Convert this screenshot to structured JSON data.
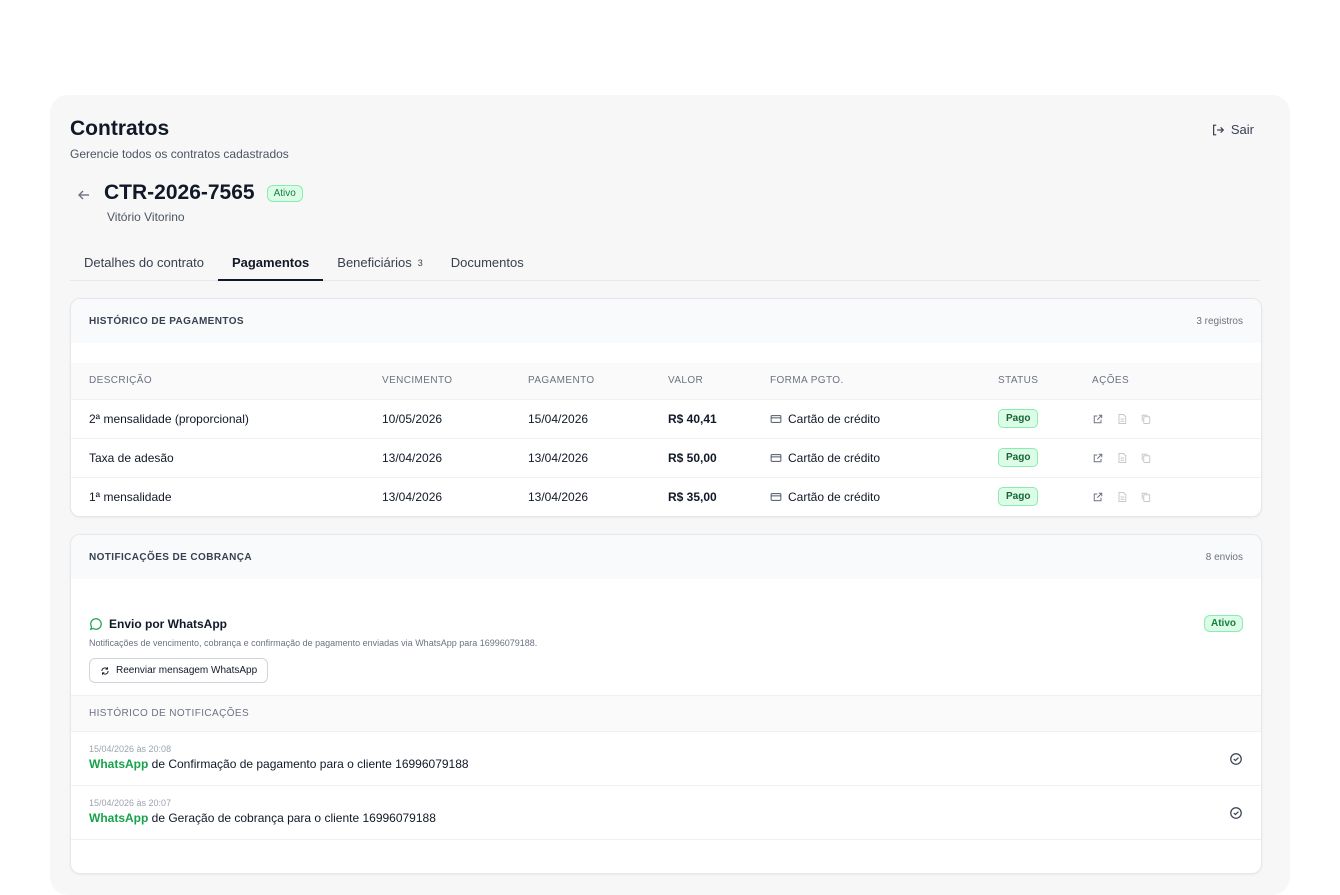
{
  "header": {
    "title": "Contratos",
    "subtitle": "Gerencie todos os contratos cadastrados",
    "logout_label": "Sair"
  },
  "contract": {
    "id": "CTR-2026-7565",
    "status": "Ativo",
    "client": "Vitório Vitorino"
  },
  "tabs": [
    {
      "label": "Detalhes do contrato",
      "active": false
    },
    {
      "label": "Pagamentos",
      "active": true
    },
    {
      "label": "Beneficiários",
      "count": "3",
      "active": false
    },
    {
      "label": "Documentos",
      "active": false
    }
  ],
  "payments": {
    "title": "HISTÓRICO DE PAGAMENTOS",
    "count": "3 registros",
    "columns": [
      "DESCRIÇÃO",
      "VENCIMENTO",
      "PAGAMENTO",
      "VALOR",
      "FORMA PGTO.",
      "STATUS",
      "AÇÕES"
    ],
    "rows": [
      {
        "descricao": "2ª mensalidade (proporcional)",
        "vencimento": "10/05/2026",
        "pagamento": "15/04/2026",
        "valor": "R$ 40,41",
        "forma": "Cartão de crédito",
        "status": "Pago"
      },
      {
        "descricao": "Taxa de adesão",
        "vencimento": "13/04/2026",
        "pagamento": "13/04/2026",
        "valor": "R$ 50,00",
        "forma": "Cartão de crédito",
        "status": "Pago"
      },
      {
        "descricao": "1ª mensalidade",
        "vencimento": "13/04/2026",
        "pagamento": "13/04/2026",
        "valor": "R$ 35,00",
        "forma": "Cartão de crédito",
        "status": "Pago"
      }
    ]
  },
  "notifications": {
    "title": "NOTIFICAÇÕES DE COBRANÇA",
    "count": "8 envios",
    "whatsapp": {
      "title": "Envio por WhatsApp",
      "status": "Ativo",
      "description": "Notificações de vencimento, cobrança e confirmação de pagamento enviadas via WhatsApp para 16996079188.",
      "resend_label": "Reenviar mensagem WhatsApp"
    },
    "history_title": "HISTÓRICO DE NOTIFICAÇÕES",
    "items": [
      {
        "time": "15/04/2026 às 20:08",
        "channel": "WhatsApp",
        "text": " de Confirmação de pagamento para o cliente 16996079188"
      },
      {
        "time": "15/04/2026 às 20:07",
        "channel": "WhatsApp",
        "text": " de Geração de cobrança para o cliente 16996079188"
      }
    ]
  },
  "colors": {
    "accent_green": "#16a34a",
    "badge_bg": "#dcfce7",
    "text_primary": "#111827"
  }
}
